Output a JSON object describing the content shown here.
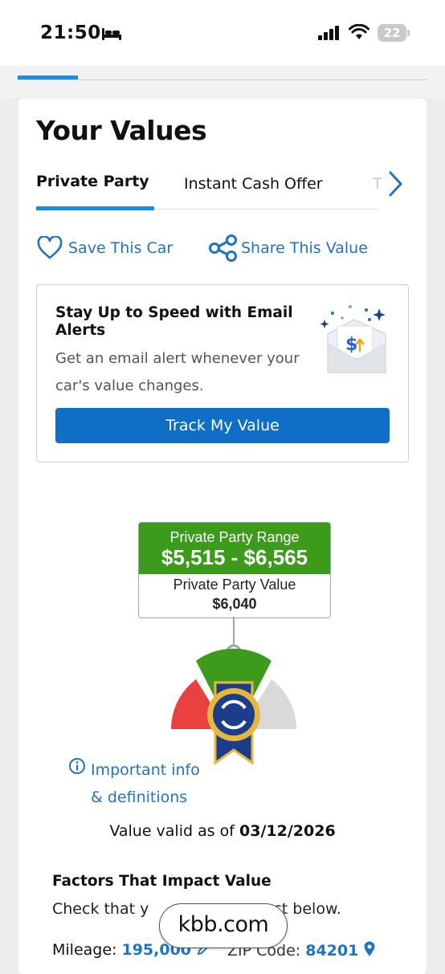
{
  "status_bar": {
    "time": "21:50",
    "battery": "22"
  },
  "page": {
    "title": "Your Values"
  },
  "tabs": [
    {
      "label": "Private Party",
      "active": true
    },
    {
      "label": "Instant Cash Offer",
      "active": false
    },
    {
      "label": "T",
      "active": false
    }
  ],
  "actions": {
    "save": "Save This Car",
    "share": "Share This Value"
  },
  "alert": {
    "title": "Stay Up to Speed with Email Alerts",
    "body": "Get an email alert whenever your car's value changes.",
    "button": "Track My Value"
  },
  "valuation": {
    "range_label": "Private Party Range",
    "range_value": "$5,515 - $6,565",
    "value_label": "Private Party Value",
    "value": "$6,040"
  },
  "info": {
    "line1": "Important info",
    "line2": "& definitions"
  },
  "valid": {
    "prefix": "Value valid as of",
    "date": "03/12/2026"
  },
  "factors": {
    "title": "Factors That Impact Value",
    "body_start": "Check that y",
    "body_end": "ct below."
  },
  "details": {
    "mileage_label": "Mileage:",
    "mileage": "195,000",
    "zip_label": "ZIP Code:",
    "zip": "84201"
  },
  "overlay": {
    "site": "kbb.com"
  },
  "colors": {
    "accent_blue": "#1f73c0",
    "button_blue": "#0f6fc6",
    "range_green": "#3d9b1c",
    "gauge_red": "#e8413f",
    "gauge_green": "#3d9b1c",
    "gauge_gray": "#d9d9d9"
  }
}
